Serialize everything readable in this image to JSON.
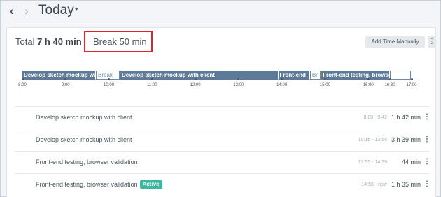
{
  "nav": {
    "prev_icon": "chevron-left-icon",
    "prev_glyph": "‹",
    "next_icon": "chevron-right-icon",
    "next_glyph": "›",
    "title": "Today",
    "caret_icon": "chevron-down-icon",
    "caret_glyph": "⌄"
  },
  "summary": {
    "total_label": "Total",
    "total_value": "7 h 40 min",
    "break_text": "Break 50 min",
    "break_highlight_color": "#d9262e"
  },
  "toolbar": {
    "add_time_label": "Add Time Manually",
    "more_icon": "more-vertical-icon",
    "more_glyph": "⋮"
  },
  "timeline": {
    "segments": [
      {
        "label": "Develop sketch mockup with client",
        "type": "work",
        "start": "8:00",
        "end": "9:42"
      },
      {
        "label": "Break",
        "type": "break",
        "start": "9:42",
        "end": "10:16"
      },
      {
        "label": "Develop sketch mockup with client",
        "type": "work",
        "start": "10:16",
        "end": "13:55"
      },
      {
        "label": "Front-end",
        "type": "work",
        "start": "13:55",
        "end": "14:39"
      },
      {
        "label": "Br",
        "type": "break",
        "start": "14:39",
        "end": "14:55"
      },
      {
        "label": "Front-end testing, browser",
        "type": "work",
        "start": "14:55",
        "end": "16:30"
      },
      {
        "label": "",
        "type": "break",
        "start": "16:30",
        "end": "17:00"
      }
    ],
    "ticks": [
      "8:00",
      "9:00",
      "10:00",
      "11:00",
      "12:00",
      "13:00",
      "14:00",
      "15:00",
      "16:00",
      "16:30",
      "17:00"
    ],
    "colors": {
      "work": "#5f7a99",
      "break": "#6d8aa8"
    }
  },
  "entries": [
    {
      "task": "Develop sketch mockup with client",
      "range": "8:00 - 9:42",
      "duration": "1 h 42 min",
      "badge": ""
    },
    {
      "task": "Develop sketch mockup with client",
      "range": "10:16 - 13:55",
      "duration": "3 h 39 min",
      "badge": ""
    },
    {
      "task": "Front-end testing, browser validation",
      "range": "13:55 - 14:39",
      "duration": "44 min",
      "badge": ""
    },
    {
      "task": "Front-end testing, browser validation",
      "range": "14:55 - now",
      "duration": "1 h 35 min",
      "badge": "Active",
      "badge_color": "#3bb7a0"
    }
  ],
  "entry_menu_icon": "more-vertical-icon",
  "entry_menu_glyph": "⋮"
}
